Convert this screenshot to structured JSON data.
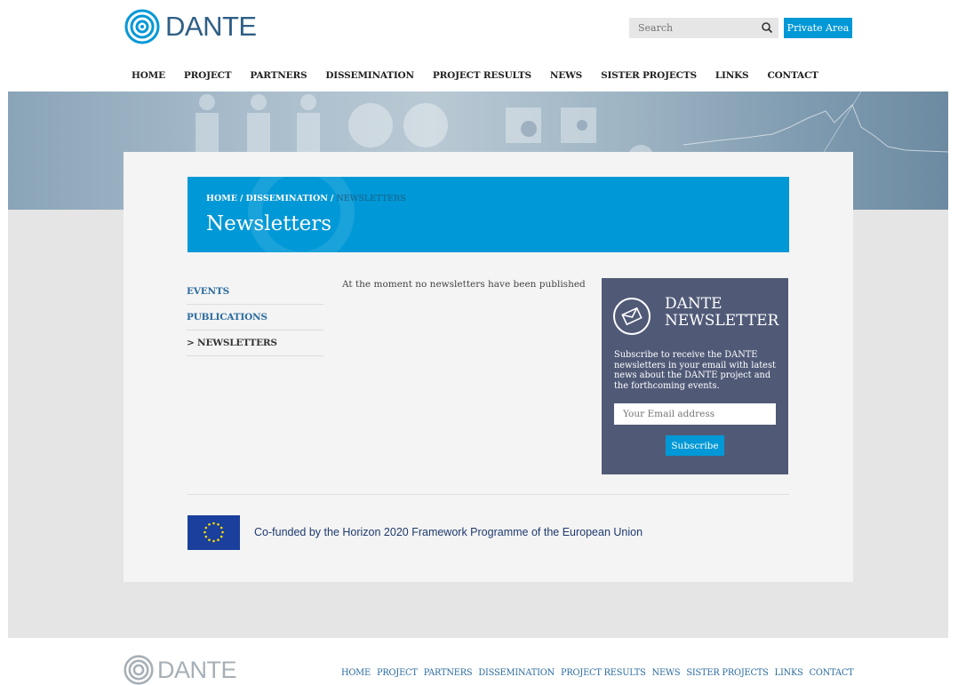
{
  "header": {
    "logo_text": "DANTE",
    "search_placeholder": "Search",
    "private_area_label": "Private Area"
  },
  "nav": {
    "items": [
      "HOME",
      "PROJECT",
      "PARTNERS",
      "DISSEMINATION",
      "PROJECT RESULTS",
      "NEWS",
      "SISTER PROJECTS",
      "LINKS",
      "CONTACT"
    ]
  },
  "breadcrumb": {
    "home": "HOME",
    "dissemination": "DISSEMINATION",
    "current": "NEWSLETTERS",
    "separator": "/"
  },
  "page_title": "Newsletters",
  "side_menu": {
    "items": [
      "EVENTS",
      "PUBLICATIONS",
      "> NEWSLETTERS"
    ]
  },
  "main": {
    "message": "At the moment no newsletters have been published"
  },
  "newsletter": {
    "title_line1": "DANTE",
    "title_line2": "NEWSLETTER",
    "description": "Subscribe to receive the DANTE newsletters in your email with latest news about the DANTE project and the forthcoming events.",
    "email_placeholder": "Your Email address",
    "subscribe_label": "Subscribe"
  },
  "funding": {
    "text": "Co-funded by the Horizon 2020 Framework Programme of the European Union"
  },
  "footer": {
    "logo_text": "DANTE",
    "nav_items": [
      "HOME",
      "PROJECT",
      "PARTNERS",
      "DISSEMINATION",
      "PROJECT RESULTS",
      "NEWS",
      "SISTER PROJECTS",
      "LINKS",
      "CONTACT"
    ]
  },
  "colors": {
    "accent": "#0098d6",
    "newsletter_bg": "#505a77",
    "link": "#2a6ba0"
  }
}
